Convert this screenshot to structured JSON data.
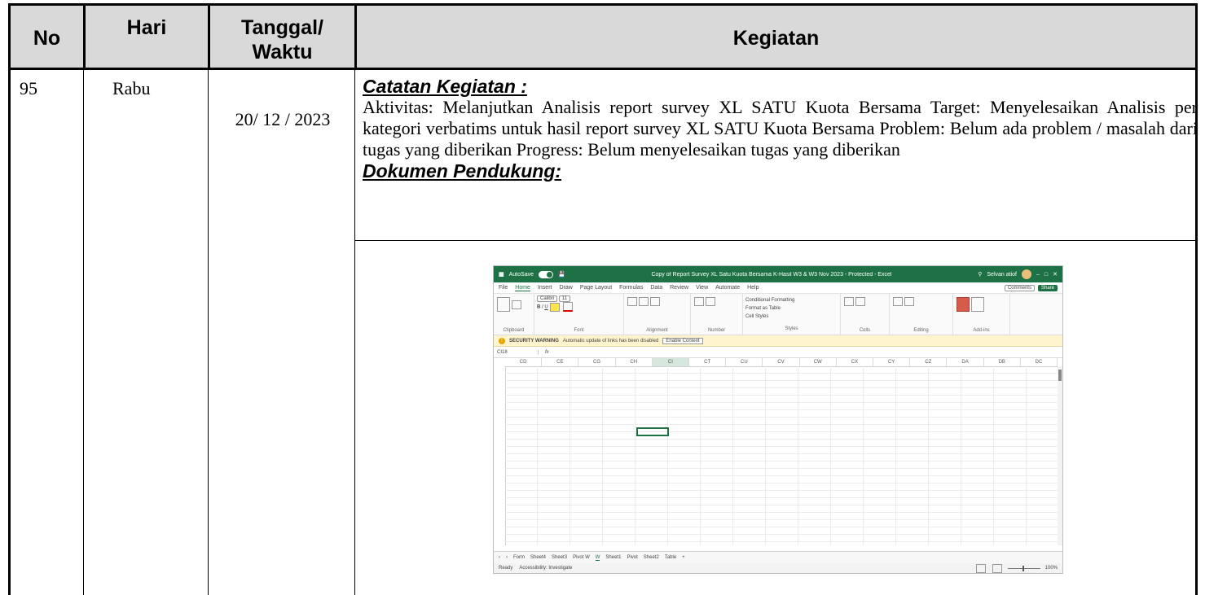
{
  "table": {
    "headers": {
      "no": "No",
      "hari": "Hari",
      "tanggal": "Tanggal/ Waktu",
      "kegiatan": "Kegiatan"
    },
    "row": {
      "no": "95",
      "hari": "Rabu",
      "tanggal": "20/ 12 / 2023",
      "catatan_heading": "Catatan Kegiatan :",
      "catatan_body": "Aktivitas: Melanjutkan Analisis report survey XL SATU Kuota Bersama Target: Menyelesaikan Analisis per kategori verbatims untuk hasil report survey XL SATU Kuota Bersama Problem: Belum ada problem / masalah dari tugas yang diberikan Progress: Belum menyelesaikan tugas yang diberikan",
      "dokumen_heading": "Dokumen Pendukung:"
    },
    "header_bg": "#d9d9d9"
  },
  "excel": {
    "accent": "#1e7145",
    "autosave": "AutoSave",
    "window_title": "Copy of Report Survey XL Satu Kuota Bersama K-Hasil W3 & W3 Nov 2023 - Protected - Excel",
    "user": "Selvan atiof",
    "menu": [
      "File",
      "Home",
      "Insert",
      "Draw",
      "Page Layout",
      "Formulas",
      "Data",
      "Review",
      "View",
      "Automate",
      "Help"
    ],
    "active_menu": "Home",
    "comments_label": "Comments",
    "share_label": "Share",
    "ribbon_groups": [
      "Clipboard",
      "Font",
      "Alignment",
      "Number",
      "Styles",
      "Cells",
      "Editing",
      "Add-ins"
    ],
    "font_name": "Calibri",
    "font_size": "11",
    "styles_items": [
      "Conditional Formatting",
      "Format as Table",
      "Cell Styles"
    ],
    "warning_title": "SECURITY WARNING",
    "warning_text": "Automatic update of links has been disabled",
    "warning_button": "Enable Content",
    "name_box": "CI18",
    "fx": "fx",
    "columns": [
      "CD",
      "CE",
      "CG",
      "CH",
      "CI",
      "CT",
      "CU",
      "CV",
      "CW",
      "CX",
      "CY",
      "CZ",
      "DA",
      "DB",
      "DC"
    ],
    "selected_column": "CI",
    "sheet_tabs": [
      "Form",
      "Sheet4",
      "Sheet3",
      "Pivot W",
      "W",
      "Sheet1",
      "Pivot",
      "Sheet2",
      "Table"
    ],
    "active_tab": "W",
    "status_left": "Ready",
    "status_access": "Accessibility: Investigate",
    "zoom": "100%"
  }
}
